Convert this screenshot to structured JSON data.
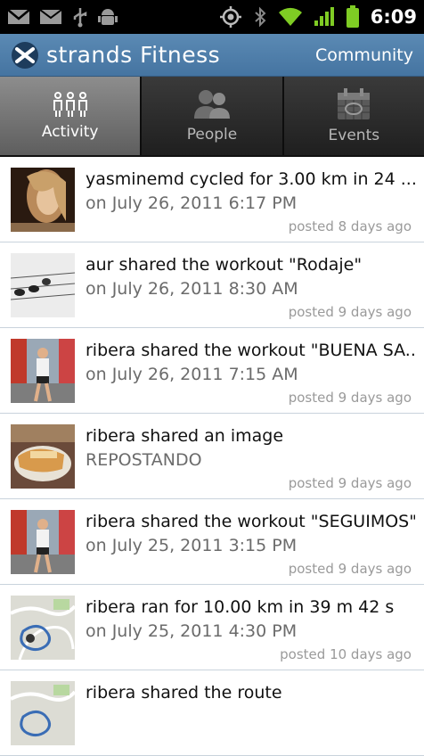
{
  "status_bar": {
    "time": "6:09",
    "icons": [
      "gmail-icon",
      "mail-icon",
      "usb-icon",
      "android-debug-icon",
      "gps-icon",
      "bluetooth-icon",
      "wifi-icon",
      "signal-icon",
      "battery-icon"
    ]
  },
  "header": {
    "app_title": "strands Fitness",
    "community_label": "Community"
  },
  "tabs": [
    {
      "label": "Activity",
      "icon": "people-group-icon",
      "active": true
    },
    {
      "label": "People",
      "icon": "people-icon",
      "active": false
    },
    {
      "label": "Events",
      "icon": "calendar-icon",
      "active": false
    }
  ],
  "feed": [
    {
      "title": "yasminemd cycled for 3.00 km in 24 ...",
      "subtitle": "on July 26, 2011 6:17 PM",
      "posted": "posted 8 days ago",
      "thumb": "portrait"
    },
    {
      "title": "aur shared the workout \"Rodaje\"",
      "subtitle": "on July 26, 2011 8:30 AM",
      "posted": "posted 9 days ago",
      "thumb": "birds"
    },
    {
      "title": "ribera shared the workout \"BUENA SA...",
      "subtitle": "on July 26, 2011 7:15 AM",
      "posted": "posted 9 days ago",
      "thumb": "runner"
    },
    {
      "title": "ribera shared an image",
      "subtitle": "REPOSTANDO",
      "posted": "posted 9 days ago",
      "thumb": "food"
    },
    {
      "title": "ribera shared the workout \"SEGUIMOS\"",
      "subtitle": "on July 25, 2011 3:15 PM",
      "posted": "posted 9 days ago",
      "thumb": "runner"
    },
    {
      "title": "ribera ran for 10.00 km in 39 m 42 s",
      "subtitle": "on July 25, 2011 4:30 PM",
      "posted": "posted 10 days ago",
      "thumb": "map"
    },
    {
      "title": "ribera shared the route",
      "subtitle": "",
      "posted": "",
      "thumb": "map"
    }
  ]
}
